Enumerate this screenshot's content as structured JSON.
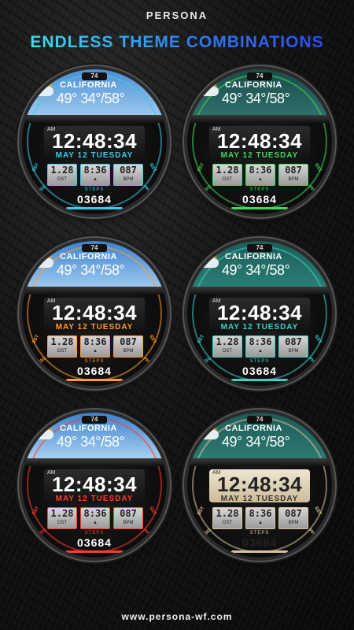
{
  "header": {
    "brand": "PERSONA",
    "headline": "ENDLESS THEME COMBINATIONS"
  },
  "footer": {
    "url": "www.persona-wf.com"
  },
  "watch_common": {
    "battery": "74",
    "city": "CALIFORNIA",
    "temps": "49° 34°/58°",
    "am": "AM",
    "time": "12:48:34",
    "date": "MAY 12 TUESDAY",
    "lcd": [
      {
        "value": "1.28",
        "label": "DST"
      },
      {
        "value": "8:36",
        "label": ""
      },
      {
        "value": "087",
        "label": "BPM"
      }
    ],
    "sst": "SST",
    "msg": "MSG",
    "phn": "PHN",
    "steps_label": "STEPS",
    "steps": "03684"
  },
  "themes": [
    {
      "name": "cyan",
      "accent": "#3ecbe6",
      "sky": "linear-gradient(#4a8fd4,#9cc7ee)"
    },
    {
      "name": "green",
      "accent": "#3fd85a",
      "sky": "linear-gradient(#1b4a4a,#2f6f6a)"
    },
    {
      "name": "orange",
      "accent": "#ff9a2e",
      "sky": "linear-gradient(#3a82d0,#9cc7ee)"
    },
    {
      "name": "teal",
      "accent": "#3bd1c9",
      "sky": "linear-gradient(#1d5d58,#2b7d76)"
    },
    {
      "name": "red",
      "accent": "#ff3b2e",
      "sky": "linear-gradient(#3a82d0,#a8cfee)"
    },
    {
      "name": "parchment",
      "accent": "#d8c49a",
      "sky": "linear-gradient(#1e5a54,#2d7a73)"
    }
  ]
}
